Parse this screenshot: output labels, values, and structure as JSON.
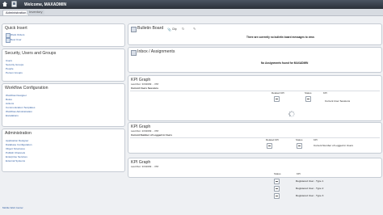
{
  "header": {
    "welcome": "Welcome, MAXADMIN"
  },
  "tabs": [
    "Administration",
    "Inventory"
  ],
  "quick_insert": {
    "title": "Quick Insert",
    "items": [
      "Work Orders",
      "New User"
    ]
  },
  "security": {
    "title": "Security, Users and Groups",
    "links": [
      "Users",
      "Security Groups",
      "People",
      "Person Groups"
    ]
  },
  "workflow": {
    "title": "Workflow Configuration",
    "links": [
      "Workflow Designer",
      "Roles",
      "Actions",
      "Communication Templates",
      "Workflow Administration",
      "Escalations"
    ]
  },
  "administration": {
    "title": "Administration",
    "links": [
      "Application Designer",
      "Database Configuration",
      "Object Structures",
      "Publish Channels",
      "Enterprise Services",
      "External Systems"
    ]
  },
  "bulletin": {
    "title": "Bulletin Board",
    "toolbar": [
      "Clip"
    ],
    "message": "There are currently no bulletin board messages to view."
  },
  "inbox": {
    "title": "Inbox / Assignments",
    "message": "No Assignments found for MAXADMIN"
  },
  "kpi1": {
    "title": "KPI Graph",
    "last_run": "Last Run: 3/3/2009 ... PM",
    "name": "Current Users Sessions",
    "columns": [
      "Related KPI",
      "Status",
      "KPI"
    ],
    "rows": [
      {
        "kpi": "Current User Sessions"
      }
    ]
  },
  "kpi2": {
    "title": "KPI Graph",
    "last_run": "Last Run: 2/3/2009 ... PM",
    "name": "Current Number of Logged in Users",
    "columns": [
      "Related KPI",
      "Status",
      "KPI"
    ],
    "rows": [
      {
        "kpi": "Current Number of Logged in Users"
      }
    ]
  },
  "kpi3": {
    "title": "KPI Graph",
    "last_run": "Last Run: 3/3/2009 ... PM",
    "columns": [
      "Status",
      "KPI"
    ],
    "rows": [
      {
        "kpi": "Registered User - Type 1"
      },
      {
        "kpi": "Registered User - Type 2"
      },
      {
        "kpi": "Registered User - Type 3"
      }
    ]
  },
  "footer": "Mobile Web Center"
}
